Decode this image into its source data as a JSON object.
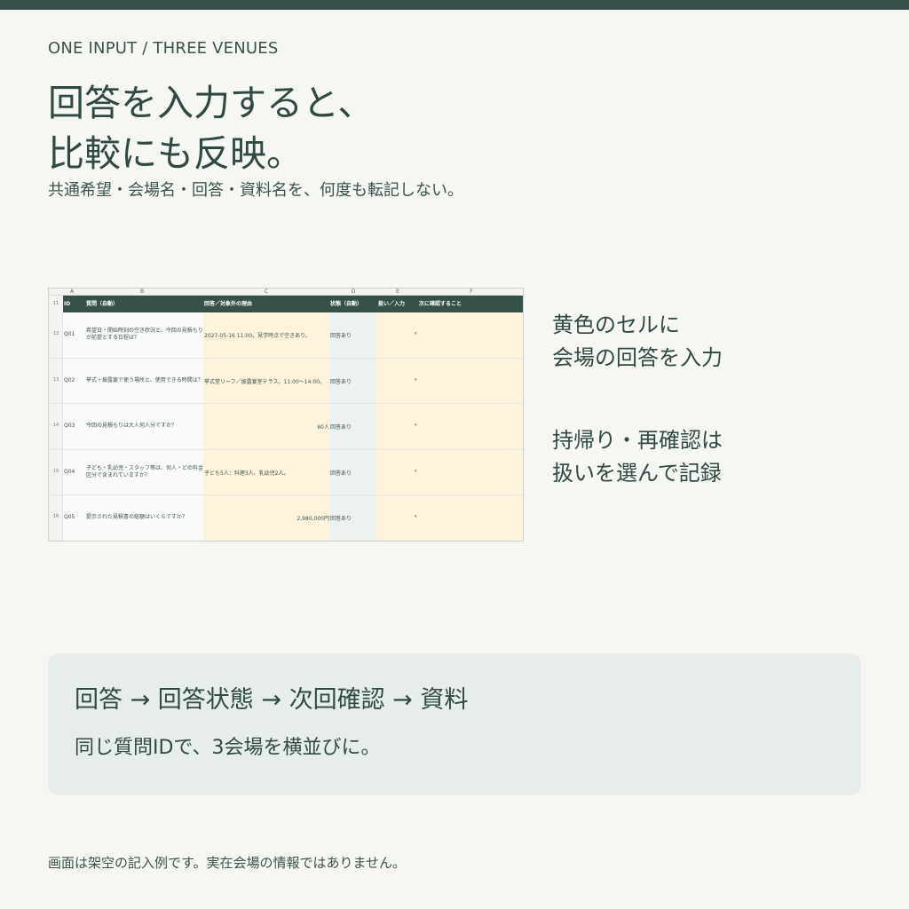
{
  "eyebrow": "ONE INPUT / THREE VENUES",
  "headline": {
    "line1": "回答を入力すると、",
    "line2": "比較にも反映。"
  },
  "subline": "共通希望・会場名・回答・資料名を、何度も転記しない。",
  "colors": {
    "accent": "#355149",
    "background": "#f6f6f2",
    "input_yellow": "#fff3dc",
    "status_green": "#eef2ee",
    "card": "#e7edea"
  },
  "sheet": {
    "column_letters": [
      "A",
      "B",
      "C",
      "D",
      "E",
      "F"
    ],
    "header": {
      "row_number": "11",
      "cols": [
        "ID",
        "質問（自動）",
        "回答／対象外の理由",
        "状態（自動）",
        "扱い／入力",
        "次に確認すること"
      ]
    },
    "rows": [
      {
        "row_number": "12",
        "id": "Q01",
        "question": "希望日・開始時刻の空き状況と、今回の見積もりが前提とする日程は？",
        "answer": "2027-05-16 11:00。見学時点で空きあり。",
        "answer_numeric": false,
        "status": "回答あり",
        "dropdown_icon": "▾"
      },
      {
        "row_number": "13",
        "id": "Q02",
        "question": "挙式・披露宴で使う場所と、使用できる時間は？",
        "answer": "挙式堂リーフ／披露宴室テラス。11:00〜14:00。",
        "answer_numeric": false,
        "status": "回答あり",
        "dropdown_icon": "▾"
      },
      {
        "row_number": "14",
        "id": "Q03",
        "question": "今回の見積もりは大人何人分ですか？",
        "answer": "60人",
        "answer_numeric": true,
        "status": "回答あり",
        "dropdown_icon": "▾"
      },
      {
        "row_number": "15",
        "id": "Q04",
        "question": "子ども・乳幼児・スタッフ等は、何人・どの料金区分で含まれていますか？",
        "answer": "子ども5人：料理3人、乳幼児2人。",
        "answer_numeric": false,
        "status": "回答あり",
        "dropdown_icon": "▾"
      },
      {
        "row_number": "16",
        "id": "Q05",
        "question": "提示された見積書の総額はいくらですか？",
        "answer": "2,980,000円",
        "answer_numeric": true,
        "status": "回答あり",
        "dropdown_icon": "▾"
      }
    ]
  },
  "notes": {
    "note1": {
      "line1": "黄色のセルに",
      "line2": "会場の回答を入力"
    },
    "note2": {
      "line1": "持帰り・再確認は",
      "line2": "扱いを選んで記録"
    }
  },
  "flow_card": {
    "title": "回答 → 回答状態 → 次回確認 → 資料",
    "subtitle": "同じ質問IDで、3会場を横並びに。"
  },
  "footnote": "画面は架空の記入例です。実在会場の情報ではありません。"
}
